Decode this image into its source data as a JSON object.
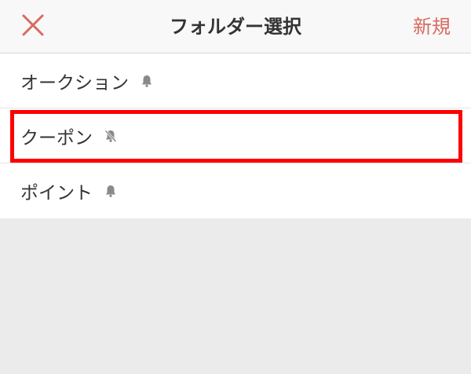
{
  "header": {
    "title": "フォルダー選択",
    "new_label": "新規",
    "close_icon": "close-icon",
    "accent_color": "#d96a5f"
  },
  "folders": [
    {
      "label": "オークション",
      "notification": "on",
      "icon": "bell-icon"
    },
    {
      "label": "クーポン",
      "notification": "off",
      "icon": "bell-off-icon",
      "highlighted": true
    },
    {
      "label": "ポイント",
      "notification": "on",
      "icon": "bell-icon"
    }
  ],
  "highlight_color": "#ff0000"
}
